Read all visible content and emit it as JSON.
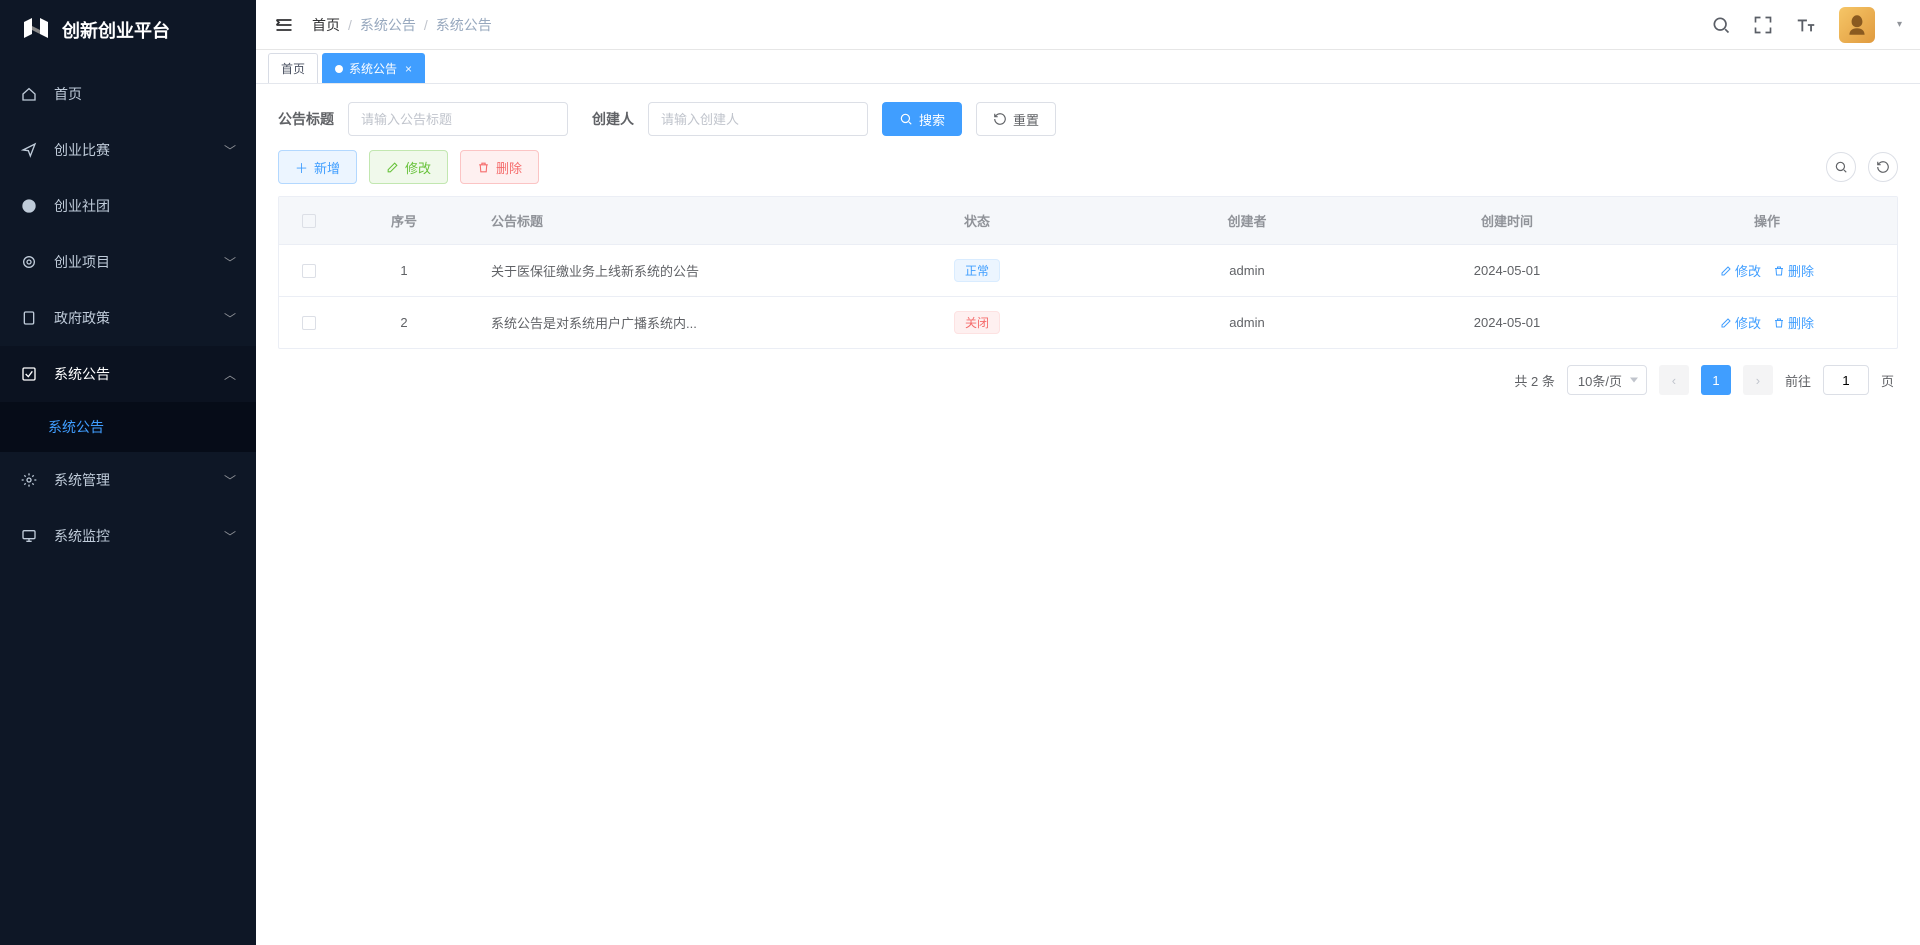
{
  "app": {
    "title": "创新创业平台"
  },
  "sidebar": {
    "items": [
      {
        "icon": "home",
        "label": "首页"
      },
      {
        "icon": "send",
        "label": "创业比赛",
        "chev": "down"
      },
      {
        "icon": "github",
        "label": "创业社团"
      },
      {
        "icon": "target",
        "label": "创业项目",
        "chev": "down"
      },
      {
        "icon": "doc",
        "label": "政府政策",
        "chev": "down"
      },
      {
        "icon": "check",
        "label": "系统公告",
        "chev": "up",
        "active": true,
        "children": [
          {
            "label": "系统公告",
            "active": true
          }
        ]
      },
      {
        "icon": "gear",
        "label": "系统管理",
        "chev": "down"
      },
      {
        "icon": "monitor",
        "label": "系统监控",
        "chev": "down"
      }
    ]
  },
  "breadcrumb": {
    "items": [
      "首页",
      "系统公告",
      "系统公告"
    ],
    "sep": "/"
  },
  "tabs": [
    {
      "label": "首页",
      "active": false,
      "closable": false
    },
    {
      "label": "系统公告",
      "active": true,
      "closable": true
    }
  ],
  "filters": {
    "title_label": "公告标题",
    "title_placeholder": "请输入公告标题",
    "creator_label": "创建人",
    "creator_placeholder": "请输入创建人",
    "search_btn": "搜索",
    "reset_btn": "重置"
  },
  "actions": {
    "add": "新增",
    "edit": "修改",
    "delete": "删除"
  },
  "table": {
    "columns": [
      "序号",
      "公告标题",
      "状态",
      "创建者",
      "创建时间",
      "操作"
    ],
    "status_labels": {
      "normal": "正常",
      "closed": "关闭"
    },
    "row_actions": {
      "edit": "修改",
      "delete": "删除"
    },
    "rows": [
      {
        "index": "1",
        "title": "关于医保征缴业务上线新系统的公告",
        "status": "normal",
        "creator": "admin",
        "created_at": "2024-05-01"
      },
      {
        "index": "2",
        "title": "系统公告是对系统用户广播系统内...",
        "status": "closed",
        "creator": "admin",
        "created_at": "2024-05-01"
      }
    ]
  },
  "pagination": {
    "total_text": "共 2 条",
    "page_size_label": "10条/页",
    "current": "1",
    "goto_prefix": "前往",
    "goto_value": "1",
    "goto_suffix": "页"
  }
}
